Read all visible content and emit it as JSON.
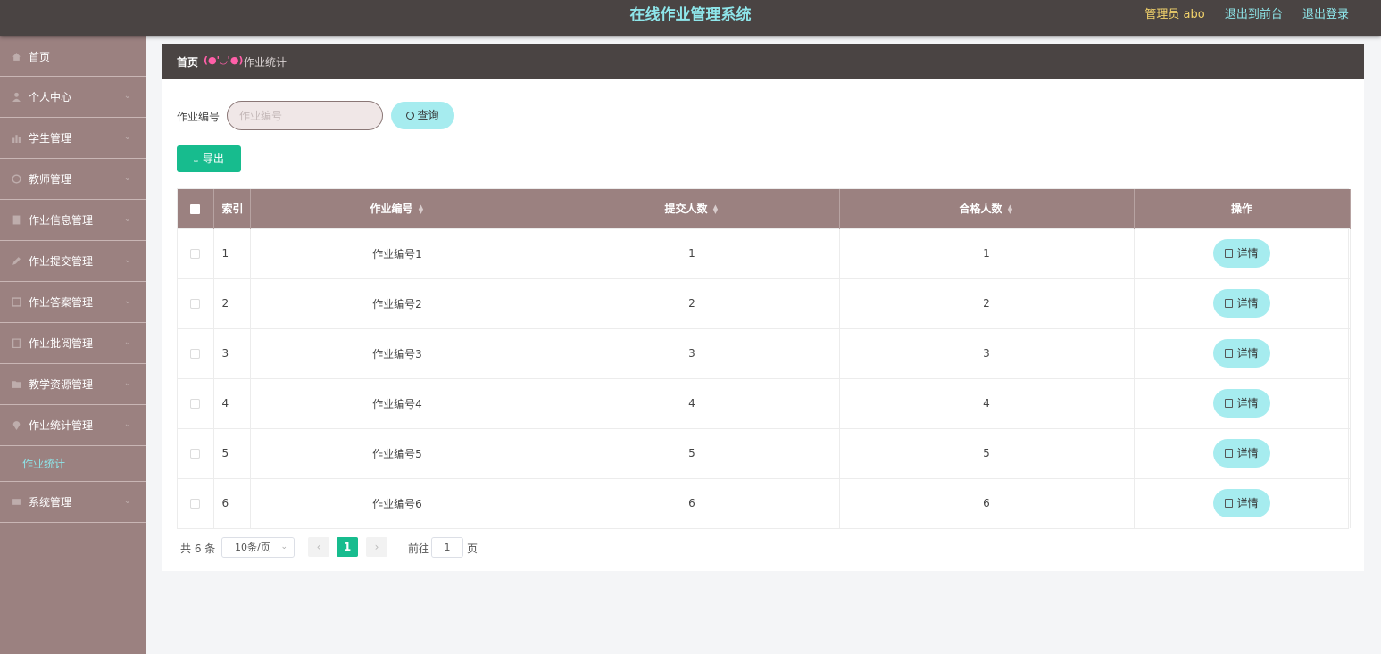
{
  "header": {
    "title": "在线作业管理系统",
    "user": "管理员 abo",
    "links": [
      "退出到前台",
      "退出登录"
    ]
  },
  "sidebar": {
    "items": [
      {
        "label": "首页",
        "icon": "home-icon",
        "arrow": false
      },
      {
        "label": "个人中心",
        "icon": "user-icon",
        "arrow": true
      },
      {
        "label": "学生管理",
        "icon": "chart-icon",
        "arrow": true
      },
      {
        "label": "教师管理",
        "icon": "circle-icon",
        "arrow": true
      },
      {
        "label": "作业信息管理",
        "icon": "document-icon",
        "arrow": true
      },
      {
        "label": "作业提交管理",
        "icon": "pen-icon",
        "arrow": true
      },
      {
        "label": "作业答案管理",
        "icon": "box-icon",
        "arrow": true
      },
      {
        "label": "作业批阅管理",
        "icon": "clipboard-icon",
        "arrow": true
      },
      {
        "label": "教学资源管理",
        "icon": "folder-icon",
        "arrow": true
      },
      {
        "label": "作业统计管理",
        "icon": "location-icon",
        "arrow": true,
        "sub": "作业统计"
      },
      {
        "label": "系统管理",
        "icon": "settings-icon",
        "arrow": true
      }
    ]
  },
  "breadcrumb": {
    "home": "首页",
    "separator": "(●'◡'●)",
    "current": "作业统计"
  },
  "search": {
    "label": "作业编号",
    "placeholder": "作业编号",
    "query_button": "查询",
    "export_button": "导出"
  },
  "table": {
    "columns": [
      "索引",
      "作业编号",
      "提交人数",
      "合格人数",
      "操作"
    ],
    "action_label": "详情",
    "rows": [
      {
        "index": "1",
        "code": "作业编号1",
        "submitted": "1",
        "qualified": "1"
      },
      {
        "index": "2",
        "code": "作业编号2",
        "submitted": "2",
        "qualified": "2"
      },
      {
        "index": "3",
        "code": "作业编号3",
        "submitted": "3",
        "qualified": "3"
      },
      {
        "index": "4",
        "code": "作业编号4",
        "submitted": "4",
        "qualified": "4"
      },
      {
        "index": "5",
        "code": "作业编号5",
        "submitted": "5",
        "qualified": "5"
      },
      {
        "index": "6",
        "code": "作业编号6",
        "submitted": "6",
        "qualified": "6"
      }
    ]
  },
  "pagination": {
    "total": "共 6 条",
    "page_size": "10条/页",
    "current_page": "1",
    "goto_label": "前往",
    "goto_value": "1",
    "page_unit": "页"
  },
  "colors": {
    "topbar": "#4a4443",
    "sidebar": "#9b8180",
    "accent_cyan": "#8ee6ea",
    "accent_green": "#17bc8e",
    "button_light": "#a6ecef"
  }
}
